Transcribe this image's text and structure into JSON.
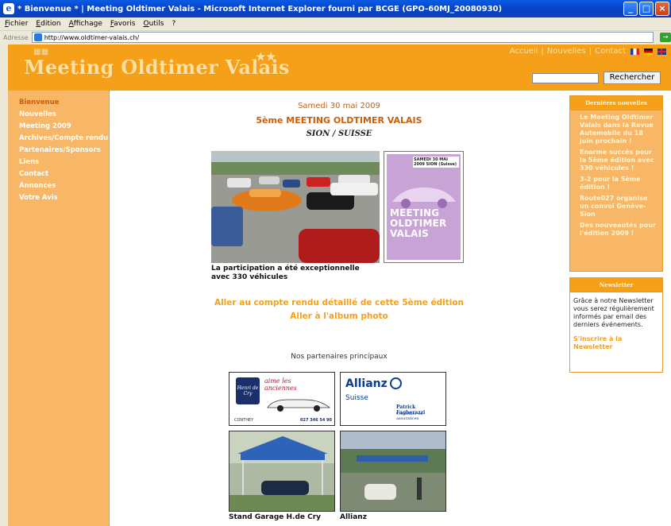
{
  "window": {
    "title": "* Bienvenue * | Meeting Oldtimer Valais - Microsoft Internet Explorer fourni par BCGE (GPO-60MJ_20080930)",
    "menu": [
      "Fichier",
      "Edition",
      "Affichage",
      "Favoris",
      "Outils",
      "?"
    ],
    "address_label": "Adresse",
    "address_url": "http://www.oldtimer-valais.ch/"
  },
  "site": {
    "logo_text": "Meeting Oldtimer Valais",
    "top_nav": [
      "Accueil",
      "Nouvelles",
      "Contact"
    ],
    "search_button": "Rechercher"
  },
  "sidebar": {
    "items": [
      "Bienvenue",
      "Nouvelles",
      "Meeting 2009",
      "Archives/Compte rendu",
      "Partenaires/Sponsors",
      "Liens",
      "Contact",
      "Annonces",
      "Votre Avis"
    ]
  },
  "main": {
    "date": "Samedi 30 mai 2009",
    "event_title": "5ème MEETING OLDTIMER VALAIS",
    "event_place": "SION / SUISSE",
    "poster_date": "SAMEDI 30 MAI 2009 SION (Suisse)",
    "poster_title": "MEETING OLDTIMER VALAIS",
    "caption_line1": "La participation a été exceptionnelle",
    "caption_line2": "avec 330 véhicules",
    "link_report": "Aller au compte rendu détaillé de cette 5ème édition",
    "link_album": "Aller à l'album photo",
    "partners_heading": "Nos partenaires principaux",
    "partner1_slogan_line1": "aime les",
    "partner1_slogan_line2": "anciennes",
    "partner1_place": "CONTHEY",
    "partner1_phone": "027 346 54 90",
    "partner2_name": "Allianz",
    "partner2_sub": "Suisse",
    "partner2_agent": "Patrick Fagherazzi",
    "partner2_role": "Conseiller en assurances",
    "photo3_caption": "Stand Garage H.de Cry",
    "photo4_caption": "Allianz"
  },
  "news": {
    "title": "Dernières nouvelles",
    "items": [
      "Le Meeting Oldtimer Valais dans la Revue Automobile du 18 juin prochain !",
      "Enorme succès pour la 5ème édition avec 330 véhicules !",
      "3-2 pour la 5ème édition !",
      "Route027 organise un convoi Genève-Sion",
      "Des nouveautés pour l'édition 2009 !"
    ]
  },
  "newsletter": {
    "title": "Newsletter",
    "text": "Grâce à notre Newsletter vous serez régulièrement informés par email des derniers événements.",
    "link": "S'inscrire à la Newsletter"
  },
  "colors": {
    "header_orange": "#f6a019",
    "sidebar_orange": "#f8b766",
    "accent_text": "#c8600a"
  }
}
